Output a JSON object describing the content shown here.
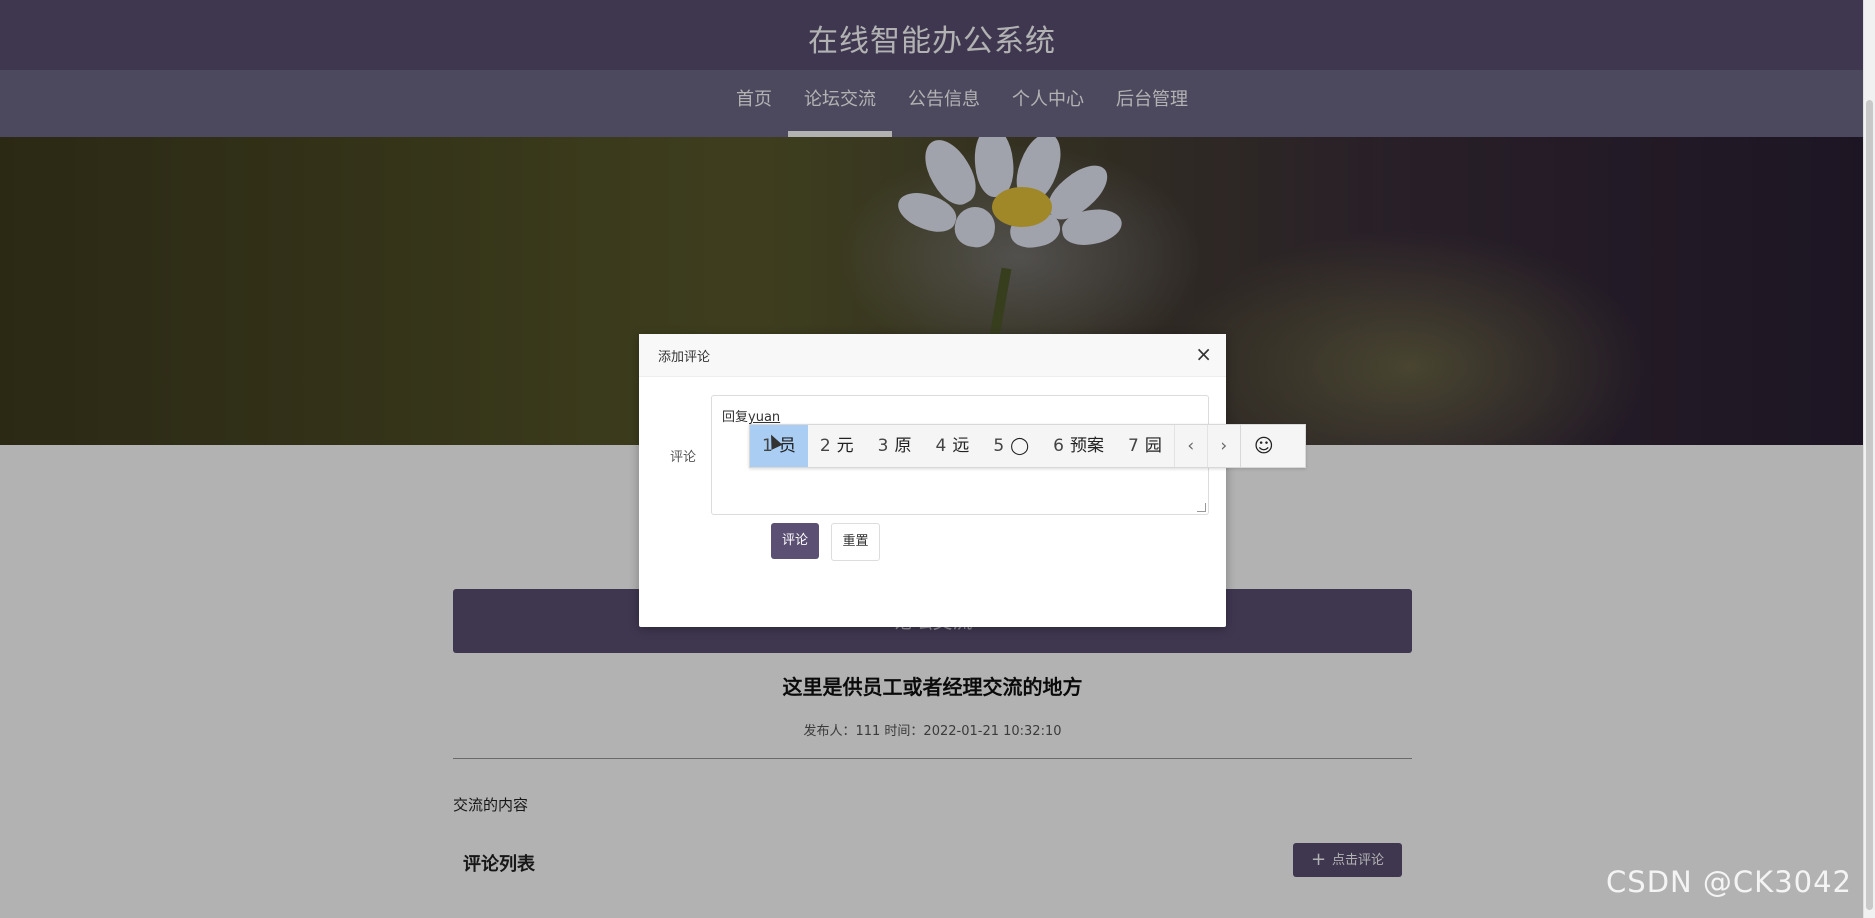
{
  "header": {
    "title": "在线智能办公系统"
  },
  "nav": {
    "items": [
      {
        "label": "首页"
      },
      {
        "label": "论坛交流"
      },
      {
        "label": "公告信息"
      },
      {
        "label": "个人中心"
      },
      {
        "label": "后台管理"
      }
    ],
    "active": "论坛交流"
  },
  "forum": {
    "section_title": "论坛交流",
    "post_title": "这里是供员工或者经理交流的地方",
    "post_meta": "发布人：111 时间：2022-01-21 10:32:10",
    "post_content": "交流的内容",
    "comments_heading": "评论列表",
    "add_comment_button": "点击评论"
  },
  "dialog": {
    "title": "添加评论",
    "close_glyph": "×",
    "field_label": "评论",
    "textarea_value_prefix": "回复",
    "textarea_value_composing": "yuan",
    "submit_label": "评论",
    "reset_label": "重置"
  },
  "ime": {
    "candidates": [
      {
        "num": "1",
        "text": "员"
      },
      {
        "num": "2",
        "text": "元"
      },
      {
        "num": "3",
        "text": "原"
      },
      {
        "num": "4",
        "text": "远"
      },
      {
        "num": "5",
        "text": "◯"
      },
      {
        "num": "6",
        "text": "预案"
      },
      {
        "num": "7",
        "text": "园"
      }
    ],
    "selected_index": 0,
    "prev_glyph": "‹",
    "next_glyph": "›",
    "emoji_glyph": "☺"
  },
  "watermark": "CSDN @CK3042",
  "colors": {
    "primary": "#5b4f73",
    "nav": "#6e6787",
    "ime_selected": "#a9cdf3"
  }
}
